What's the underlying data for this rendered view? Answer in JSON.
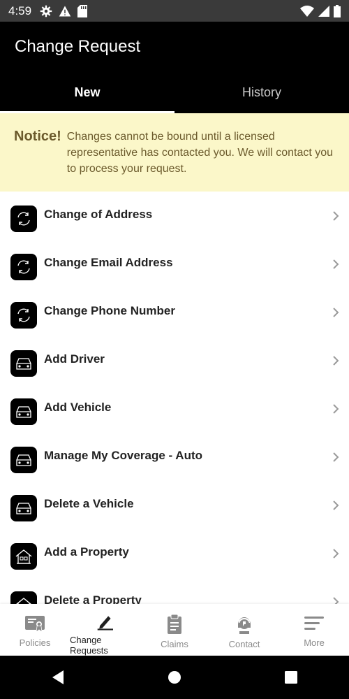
{
  "status_bar": {
    "time": "4:59"
  },
  "header": {
    "title": "Change Request"
  },
  "tabs": [
    {
      "label": "New",
      "active": true
    },
    {
      "label": "History",
      "active": false
    }
  ],
  "notice": {
    "title": "Notice!",
    "text": "Changes cannot be bound until a licensed representative has contacted you. We will contact you to process your request."
  },
  "list": {
    "items": [
      {
        "label": "Change of Address",
        "icon": "refresh-icon"
      },
      {
        "label": "Change Email Address",
        "icon": "refresh-icon"
      },
      {
        "label": "Change Phone Number",
        "icon": "refresh-icon"
      },
      {
        "label": "Add Driver",
        "icon": "car-icon"
      },
      {
        "label": "Add Vehicle",
        "icon": "car-icon"
      },
      {
        "label": "Manage My Coverage - Auto",
        "icon": "car-icon"
      },
      {
        "label": "Delete a Vehicle",
        "icon": "car-icon"
      },
      {
        "label": "Add a Property",
        "icon": "house-icon"
      },
      {
        "label": "Delete a Property",
        "icon": "house-icon"
      }
    ]
  },
  "bottom_nav": [
    {
      "label": "Policies",
      "icon": "policy-certificate-icon"
    },
    {
      "label": "Change Requests",
      "icon": "pen-icon",
      "active": true
    },
    {
      "label": "Claims",
      "icon": "clipboard-icon"
    },
    {
      "label": "Contact",
      "icon": "support-agent-icon"
    },
    {
      "label": "More",
      "icon": "menu-lines-icon"
    }
  ],
  "colors": {
    "app_bar": "#000000",
    "notice_bg": "#fbf7c9",
    "notice_text": "#6b5a2c",
    "nav_active": "#1f1f1f",
    "nav_inactive": "#8a8a8a"
  }
}
